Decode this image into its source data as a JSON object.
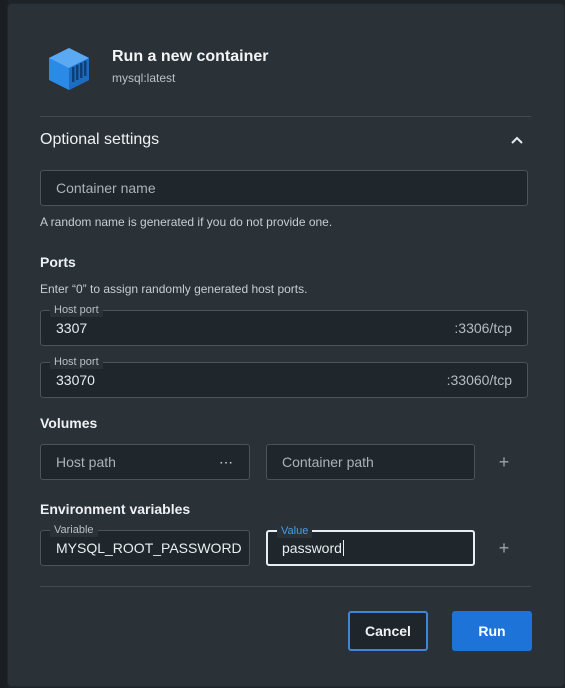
{
  "header": {
    "title": "Run a new container",
    "image": "mysql:latest",
    "logo_icon": "container-cube-icon",
    "accent": "#2a8ae6"
  },
  "optional_settings": {
    "title": "Optional settings",
    "toggle_icon": "chevron-up-icon",
    "container_name": {
      "value": "",
      "placeholder": "Container name",
      "helper": "A random name is generated if you do not provide one."
    }
  },
  "ports": {
    "title": "Ports",
    "helper": "Enter “0” to assign randomly generated host ports.",
    "mappings": [
      {
        "label": "Host port",
        "value": "3307",
        "container_port": ":3306/tcp"
      },
      {
        "label": "Host port",
        "value": "33070",
        "container_port": ":33060/tcp"
      }
    ]
  },
  "volumes": {
    "title": "Volumes",
    "host_path_placeholder": "Host path",
    "browse_icon": "ellipsis-icon",
    "browse_label": "⋯",
    "container_path_placeholder": "Container path",
    "add_icon": "plus-icon",
    "add_label": "+"
  },
  "env": {
    "title": "Environment variables",
    "variable_label": "Variable",
    "variable_value": "MYSQL_ROOT_PASSWORD",
    "value_label": "Value",
    "value_value": "password",
    "add_icon": "plus-icon",
    "add_label": "+"
  },
  "actions": {
    "cancel": "Cancel",
    "run": "Run",
    "primary_color": "#1e73d8"
  }
}
